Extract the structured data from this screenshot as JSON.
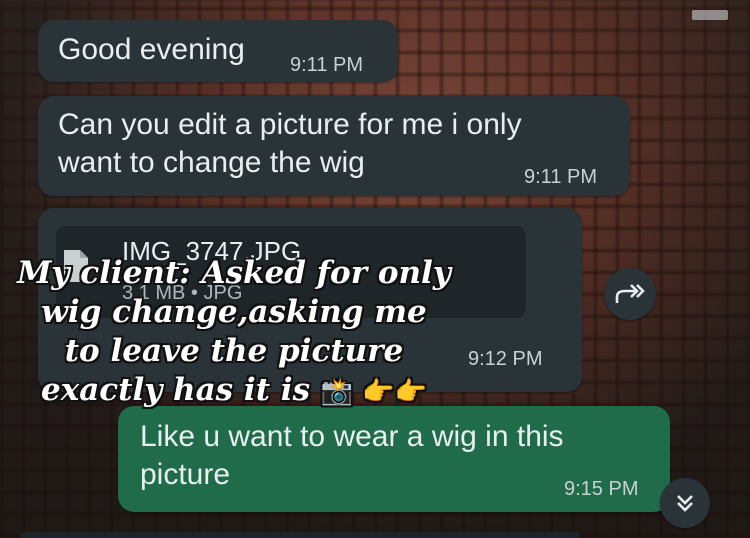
{
  "messages": [
    {
      "text": "Good evening",
      "time": "9:11 PM"
    },
    {
      "text_line1": "Can you edit a picture for me i only",
      "text_line2": "want to change the wig",
      "time": "9:11 PM"
    },
    {
      "file_name": "IMG_3747.JPG",
      "file_meta": "3.1 MB • JPG",
      "time": "9:12 PM"
    },
    {
      "text_line1": "Like u want to wear a wig in this",
      "text_line2": "picture",
      "time": "9:15 PM"
    }
  ],
  "overlay": {
    "line1": "My client: Asked for only",
    "line2": "wig change,asking me",
    "line3": "to leave the picture",
    "line4": "exactly has it is",
    "emoji": "📸 👉👉"
  },
  "icons": {
    "forward": "forward-icon",
    "scroll_down": "chevron-double-down-icon",
    "file": "file-icon"
  },
  "colors": {
    "incoming_bubble": "#2a3338",
    "outgoing_bubble": "#1f6b4a",
    "text": "#e9eef0"
  }
}
